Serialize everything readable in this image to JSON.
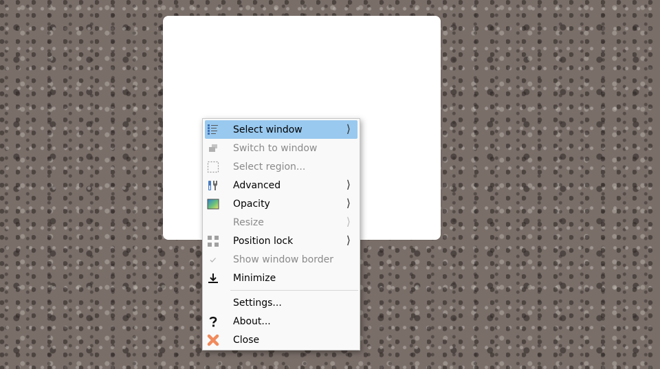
{
  "menu": {
    "items": [
      {
        "label": "Select window",
        "icon": "select-window-icon",
        "submenu": true,
        "highlighted": true
      },
      {
        "label": "Switch to window",
        "icon": "switch-window-icon",
        "disabled": true
      },
      {
        "label": "Select region...",
        "icon": "select-region-icon",
        "disabled": true
      },
      {
        "label": "Advanced",
        "icon": "tools-icon",
        "submenu": true
      },
      {
        "label": "Opacity",
        "icon": "opacity-icon",
        "submenu": true
      },
      {
        "label": "Resize",
        "icon": "",
        "submenu": true,
        "disabled": true
      },
      {
        "label": "Position lock",
        "icon": "grid-lock-icon",
        "submenu": true
      },
      {
        "label": "Show window border",
        "icon": "checkmark-icon",
        "disabled": true
      },
      {
        "label": "Minimize",
        "icon": "minimize-icon"
      },
      {
        "label": "Settings...",
        "icon": ""
      },
      {
        "label": "About...",
        "icon": "help-question-icon"
      },
      {
        "label": "Close",
        "icon": "close-x-icon"
      }
    ],
    "submenu_arrow": "⟩",
    "highlight_color": "#99c9ef",
    "disabled_color": "#8a8a8a"
  }
}
